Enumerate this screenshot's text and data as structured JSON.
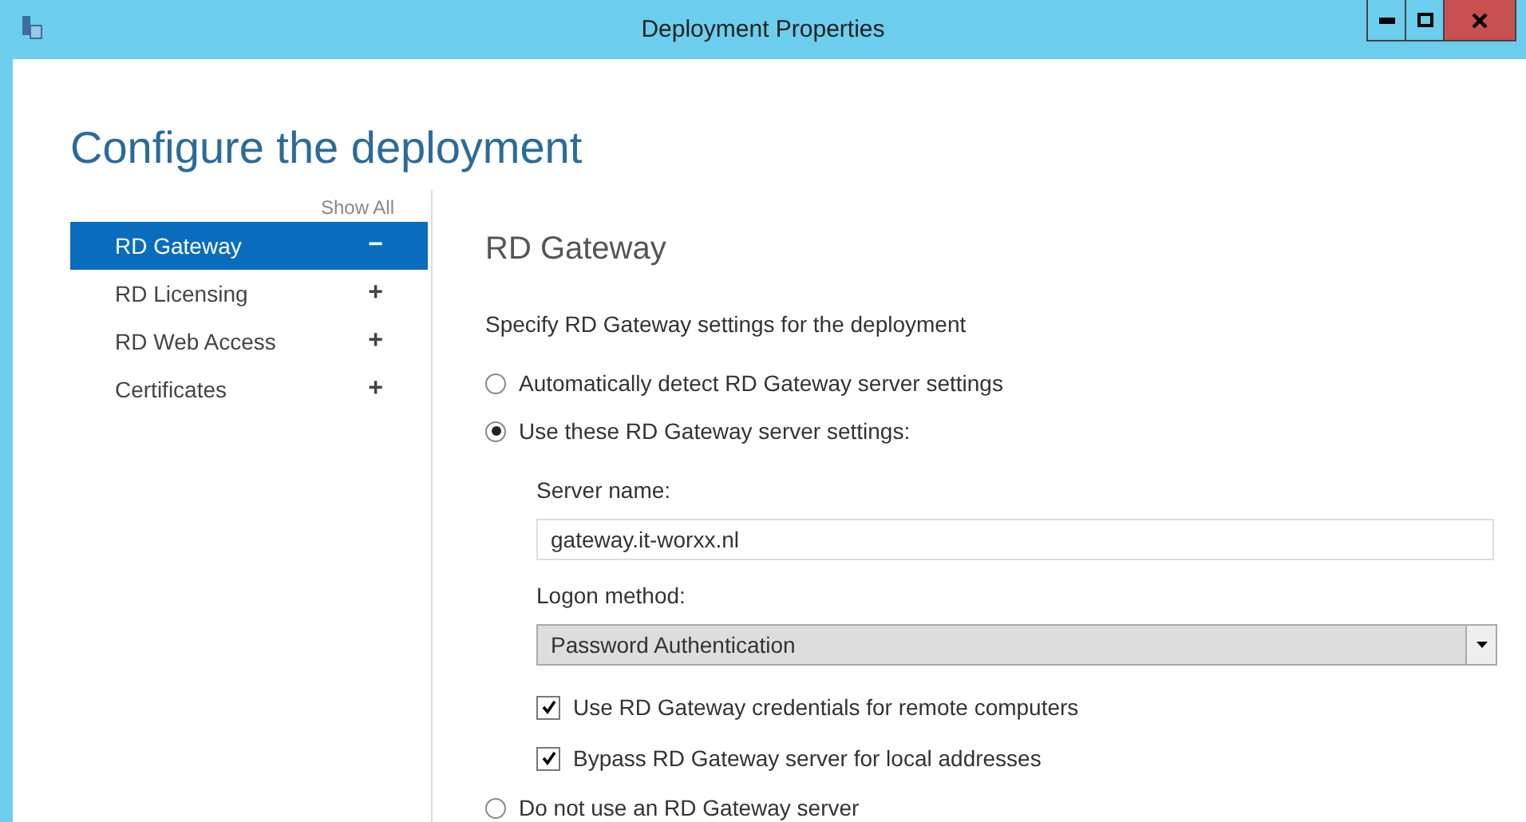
{
  "window": {
    "title": "Deployment Properties"
  },
  "heading": "Configure the deployment",
  "sidebar": {
    "show_all": "Show All",
    "items": [
      {
        "label": "RD Gateway",
        "sign": "−",
        "selected": true
      },
      {
        "label": "RD Licensing",
        "sign": "+",
        "selected": false
      },
      {
        "label": "RD Web Access",
        "sign": "+",
        "selected": false
      },
      {
        "label": "Certificates",
        "sign": "+",
        "selected": false
      }
    ]
  },
  "content": {
    "title": "RD Gateway",
    "intro": "Specify RD Gateway settings for the deployment",
    "options": [
      {
        "kind": "radio",
        "label": "Automatically detect RD Gateway server settings",
        "selected": false
      },
      {
        "kind": "radio",
        "label": "Use these RD Gateway server settings:",
        "selected": true
      },
      {
        "kind": "field",
        "label": "Server name:",
        "value": "gateway.it-worxx.nl"
      },
      {
        "kind": "dropdown",
        "label": "Logon method:",
        "value": "Password Authentication"
      },
      {
        "kind": "checkbox",
        "label": "Use RD Gateway credentials for remote computers",
        "checked": true
      },
      {
        "kind": "checkbox",
        "label": "Bypass RD Gateway server for local addresses",
        "checked": true
      },
      {
        "kind": "radio",
        "label": "Do not use an RD Gateway server",
        "selected": false
      }
    ]
  }
}
